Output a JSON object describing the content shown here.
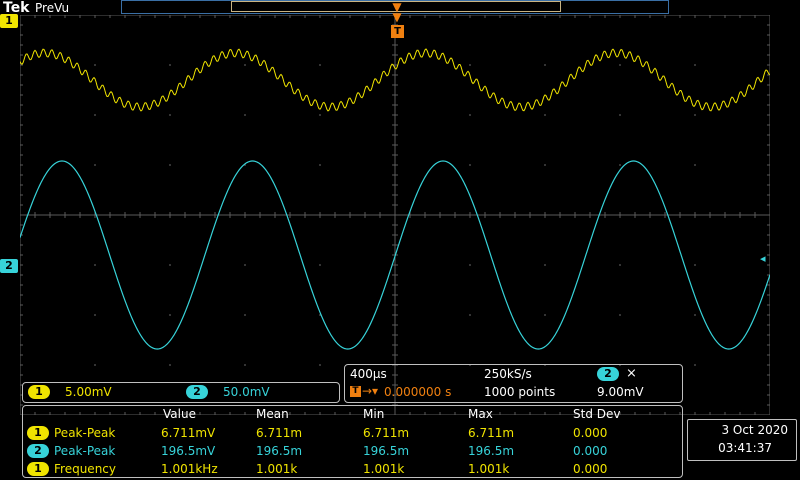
{
  "header": {
    "brand": "Tek",
    "mode": "PreVu"
  },
  "channels": {
    "ch1": {
      "number": "1",
      "scale": "5.00mV",
      "color": "#f0e400"
    },
    "ch2": {
      "number": "2",
      "scale": "50.0mV",
      "color": "#37d3d9"
    }
  },
  "timebase": {
    "time_per_div": "400µs",
    "sample_rate": "250kS/s",
    "record_length": "1000 points",
    "trigger_position": "0.000000 s",
    "trigger_channel": "2",
    "trigger_level": "9.00mV"
  },
  "measurements": {
    "headers": [
      "Value",
      "Mean",
      "Min",
      "Max",
      "Std Dev"
    ],
    "rows": [
      {
        "ch": "1",
        "name": "Peak-Peak",
        "value": "6.711mV",
        "mean": "6.711m",
        "min": "6.711m",
        "max": "6.711m",
        "std": "0.000"
      },
      {
        "ch": "2",
        "name": "Peak-Peak",
        "value": "196.5mV",
        "mean": "196.5m",
        "min": "196.5m",
        "max": "196.5m",
        "std": "0.000"
      },
      {
        "ch": "1",
        "name": "Frequency",
        "value": "1.001kHz",
        "mean": "1.001k",
        "min": "1.001k",
        "max": "1.001k",
        "std": "0.000"
      }
    ]
  },
  "datetime": {
    "date": "3 Oct  2020",
    "time": "03:41:37"
  }
}
